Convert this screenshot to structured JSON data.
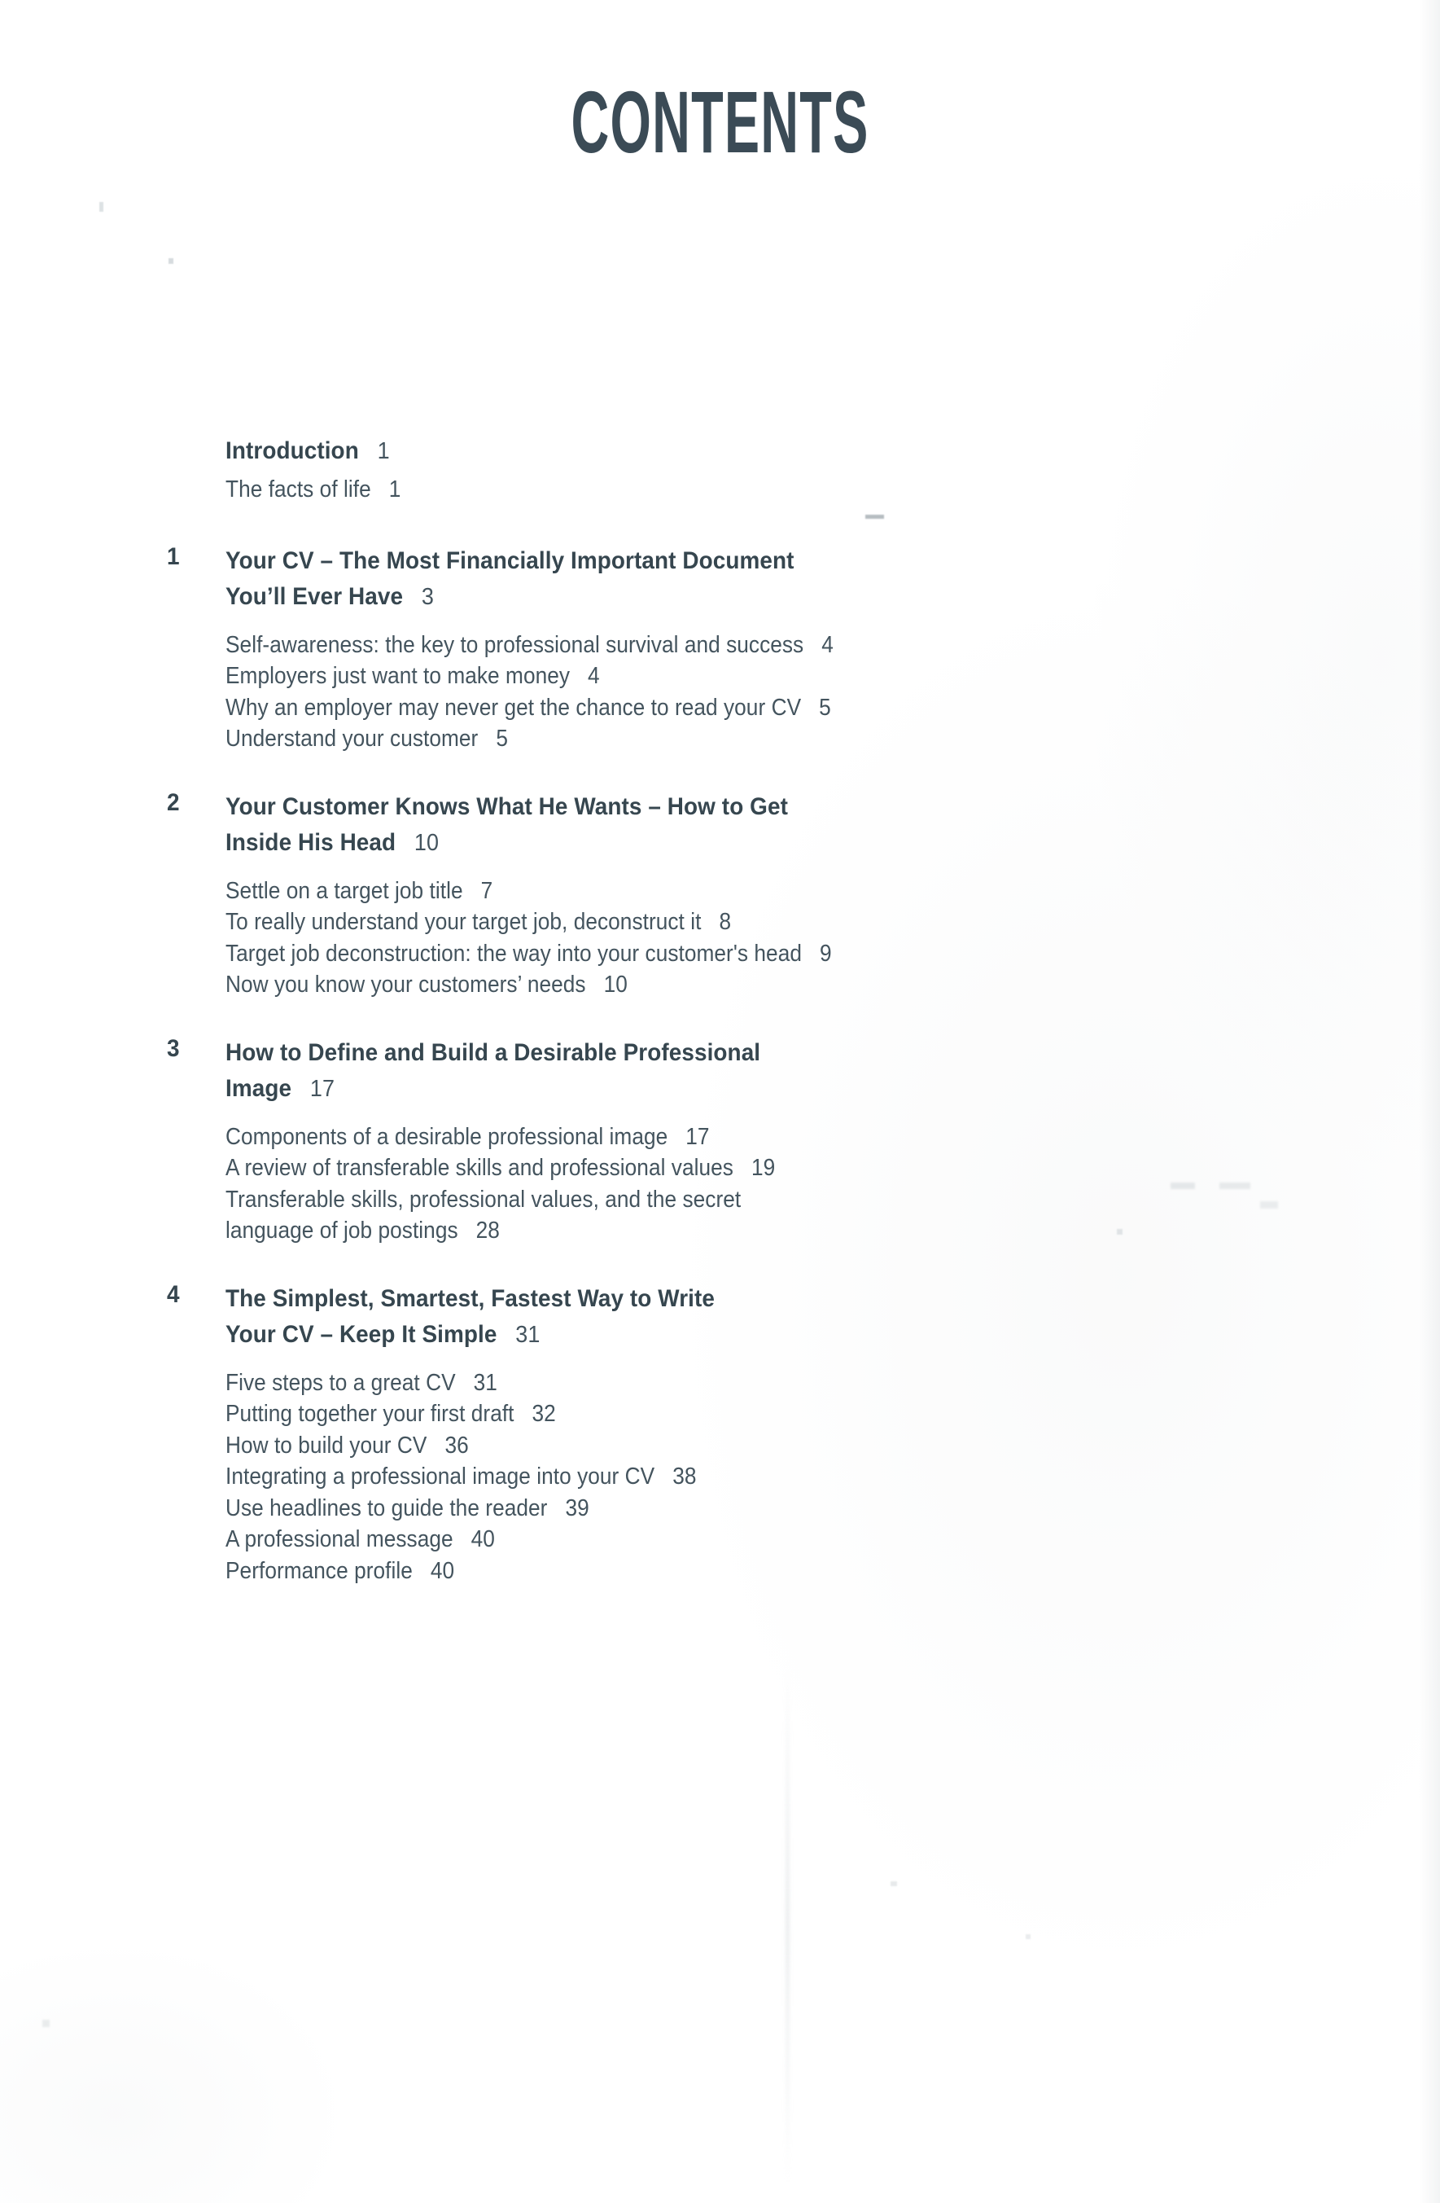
{
  "page": {
    "title": "CONTENTS",
    "text_color": "#3a4a55",
    "background_color": "#ffffff"
  },
  "front_matter": {
    "heading": "Introduction",
    "heading_page": "1",
    "entries": [
      {
        "label": "The facts of life",
        "page": "1"
      }
    ]
  },
  "chapters": [
    {
      "number": "1",
      "title_line1": "Your CV – The Most Financially Important Document",
      "title_line2": "You’ll Ever Have",
      "page": "3",
      "entries": [
        {
          "label": "Self-awareness: the key to professional survival and success",
          "page": "4"
        },
        {
          "label": "Employers just want to make money",
          "page": "4"
        },
        {
          "label": "Why an employer may never get the chance to read your CV",
          "page": "5"
        },
        {
          "label": "Understand your customer",
          "page": "5"
        }
      ]
    },
    {
      "number": "2",
      "title_line1": "Your Customer Knows What He Wants – How to Get",
      "title_line2": "Inside His Head",
      "page": "10",
      "entries": [
        {
          "label": "Settle on a target job title",
          "page": "7"
        },
        {
          "label": "To really understand your target job, deconstruct it",
          "page": "8"
        },
        {
          "label": "Target job deconstruction: the way into your customer's head",
          "page": "9"
        },
        {
          "label": "Now you know your customers’ needs",
          "page": "10"
        }
      ]
    },
    {
      "number": "3",
      "title_line1": "How to Define and Build a Desirable Professional",
      "title_line2": "Image",
      "page": "17",
      "entries": [
        {
          "label": "Components of a desirable professional image",
          "page": "17"
        },
        {
          "label": "A review of transferable skills and professional values",
          "page": "19"
        },
        {
          "label": "Transferable skills, professional values, and the secret",
          "page": ""
        },
        {
          "label": "language of job postings",
          "page": "28"
        }
      ]
    },
    {
      "number": "4",
      "title_line1": "The Simplest, Smartest, Fastest Way to Write",
      "title_line2": "Your CV – Keep It Simple",
      "page": "31",
      "entries": [
        {
          "label": "Five steps to a great CV",
          "page": "31"
        },
        {
          "label": "Putting together your first draft",
          "page": "32"
        },
        {
          "label": "How to build your CV",
          "page": "36"
        },
        {
          "label": "Integrating a professional image into your CV",
          "page": "38"
        },
        {
          "label": "Use headlines to guide the reader",
          "page": "39"
        },
        {
          "label": "A professional message",
          "page": "40"
        },
        {
          "label": "Performance profile",
          "page": "40"
        }
      ]
    }
  ]
}
